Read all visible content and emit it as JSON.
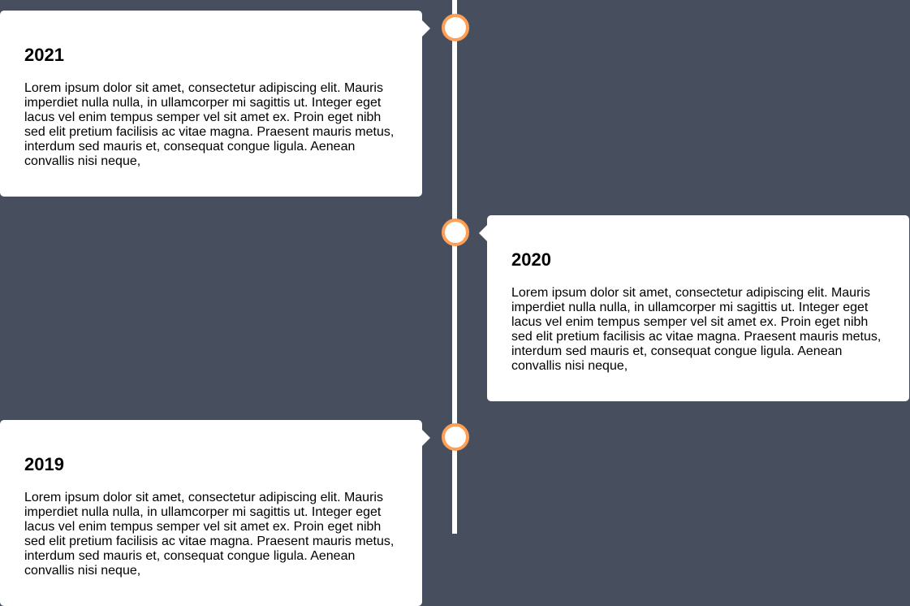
{
  "timeline": {
    "accent_color": "#ff9f55",
    "background_color": "#474e5d",
    "entries": [
      {
        "year": "2021",
        "side": "left",
        "text": "Lorem ipsum dolor sit amet, consectetur adipiscing elit. Mauris imperdiet nulla nulla, in ullamcorper mi sagittis ut. Integer eget lacus vel enim tempus semper vel sit amet ex. Proin eget nibh sed elit pretium facilisis ac vitae magna. Praesent mauris metus, interdum sed mauris et, consequat congue ligula. Aenean convallis nisi neque,"
      },
      {
        "year": "2020",
        "side": "right",
        "text": "Lorem ipsum dolor sit amet, consectetur adipiscing elit. Mauris imperdiet nulla nulla, in ullamcorper mi sagittis ut. Integer eget lacus vel enim tempus semper vel sit amet ex. Proin eget nibh sed elit pretium facilisis ac vitae magna. Praesent mauris metus, interdum sed mauris et, consequat congue ligula. Aenean convallis nisi neque,"
      },
      {
        "year": "2019",
        "side": "left",
        "text": "Lorem ipsum dolor sit amet, consectetur adipiscing elit. Mauris imperdiet nulla nulla, in ullamcorper mi sagittis ut. Integer eget lacus vel enim tempus semper vel sit amet ex. Proin eget nibh sed elit pretium facilisis ac vitae magna. Praesent mauris metus, interdum sed mauris et, consequat congue ligula. Aenean convallis nisi neque,"
      }
    ]
  }
}
